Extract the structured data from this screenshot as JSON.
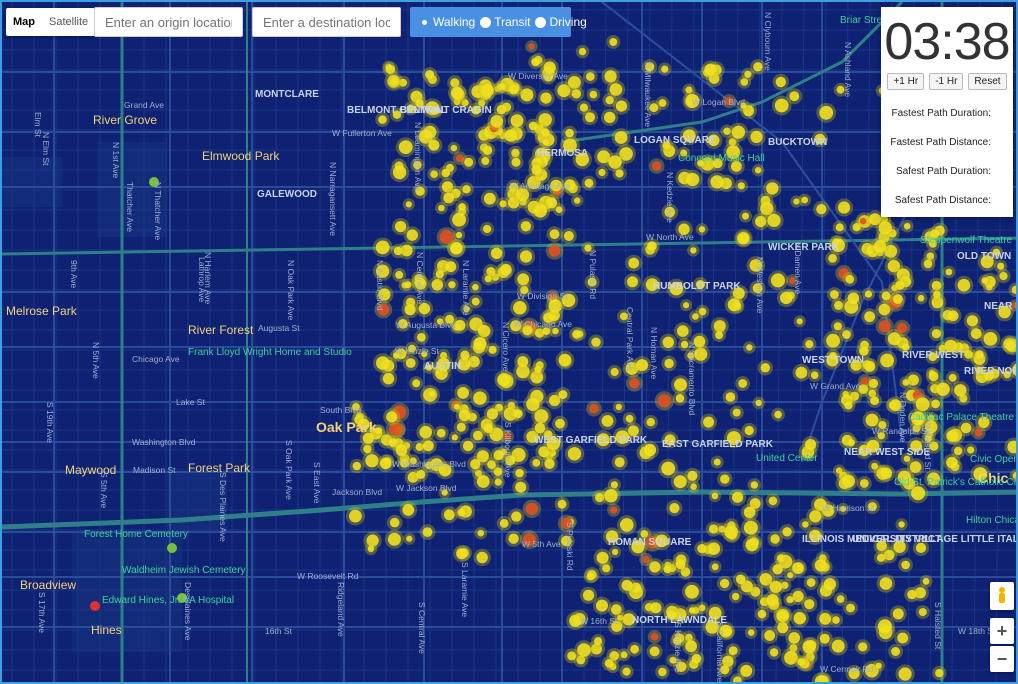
{
  "map_type": {
    "map_label": "Map",
    "satellite_label": "Satellite",
    "selected": "Map"
  },
  "origin_input": {
    "placeholder": "Enter an origin location",
    "value": ""
  },
  "destination_input": {
    "placeholder": "Enter a destination locati...",
    "value": ""
  },
  "travel_modes": {
    "walking": "Walking",
    "transit": "Transit",
    "driving": "Driving",
    "selected": "Walking"
  },
  "panel": {
    "clock": "03:38",
    "plus_hr": "+1 Hr",
    "minus_hr": "-1 Hr",
    "reset": "Reset",
    "fastest_duration": "Fastest Path Duration:",
    "fastest_distance": "Fastest Path Distance:",
    "safest_duration": "Safest Path Duration:",
    "safest_distance": "Safest Path Distance:"
  },
  "zoom": {
    "in": "+",
    "out": "−"
  },
  "colors": {
    "map_bg": "#0e2172",
    "road": "#2a4a9a",
    "highway": "#2f7f8a",
    "heat": "#f0e020",
    "heat_hot": "#e05020"
  },
  "labels": {
    "neighborhoods": [
      "MONTCLARE",
      "BELMONT CENTRAL",
      "BELMONT CRAGIN",
      "HERMOSA",
      "LOGAN SQUARE",
      "BUCKTOWN",
      "GALEWOOD",
      "WICKER PARK",
      "OLD TOWN",
      "HUMBOLDT PARK",
      "AUSTIN",
      "WEST TOWN",
      "RIVER WEST",
      "NEAR NORTH SIDE",
      "RIVER NORTH",
      "WEST GARFIELD PARK",
      "EAST GARFIELD PARK",
      "NEAR WEST SIDE",
      "HOMAN SQUARE",
      "ILLINOIS MEDICAL DISTRICT",
      "UNIVERSITY VILLAGE LITTLE ITALY",
      "NORTH LAWNDALE"
    ],
    "cities": [
      "River Grove",
      "Elmwood Park",
      "River Forest",
      "Oak Park",
      "Forest Park",
      "Maywood",
      "Broadview",
      "Hines",
      "Melrose Park",
      "Chic"
    ],
    "pois": [
      "Concord Music Hall",
      "Frank Lloyd Wright Home and Studio",
      "Forest Home Cemetery",
      "Waldheim Jewish Cemetery",
      "Edward Hines, Jr. VA Hospital",
      "Steppenwolf Theatre",
      "United Center",
      "Cadillac Palace Theatre",
      "Old St. Patrick's Catholic Church",
      "Hilton Chicago",
      "Briar Street",
      "Civic Opera"
    ],
    "streets_h": [
      "W Diversey Ave",
      "W Logan Blvd",
      "W Fullerton Ave",
      "W Armitage Ave",
      "W North Ave",
      "W Division St",
      "Augusta St",
      "W Augusta Blvd",
      "W Chicago Ave",
      "Chicago Ave",
      "Lake St",
      "W Kinzie St",
      "South Blvd",
      "Washington Blvd",
      "Madison St",
      "W Washington Blvd",
      "W Jackson Blvd",
      "Jackson Blvd",
      "W Harrison St",
      "W 5th Ave",
      "W Roosevelt Rd",
      "W 16th St",
      "16th St",
      "W Cermak Rd",
      "W 18th St",
      "Grand Ave",
      "W Grand Ave",
      "W Randolph St"
    ],
    "streets_v": [
      "N 1st Ave",
      "N Thatcher Ave",
      "Thatcher Ave",
      "N Harlem Ave",
      "N Oak Park Ave",
      "N Austin Blvd",
      "N Central Ave",
      "N Laramie Ave",
      "N Cicero Ave",
      "N Pulaski Rd",
      "N Kedzie Ave",
      "N Western Ave",
      "N Ashland Ave",
      "N Damen Ave",
      "9th Ave",
      "N 5th Ave",
      "S 19th Ave",
      "S 17th Ave",
      "S 5th Ave",
      "Desplaines Ave",
      "S Oak Park Ave",
      "S East Ave",
      "Ridgeland Ave",
      "S Central Ave",
      "S Laramie Ave",
      "S Pulaski Rd",
      "S Kedzie Ave",
      "S California Ave",
      "N Sacramento Blvd",
      "Central Park Ave",
      "N Homan Ave",
      "N Milwaukee Ave",
      "N Clybourn Ave",
      "N Halsted St",
      "N Ogden Ave",
      "S Halsted St",
      "Elm St",
      "N Elm St",
      "Lathrop Ave",
      "N Narragansett Ave",
      "S Des Plaines Ave",
      "S Kilbourn Ave",
      "N Leamington Ave"
    ]
  }
}
